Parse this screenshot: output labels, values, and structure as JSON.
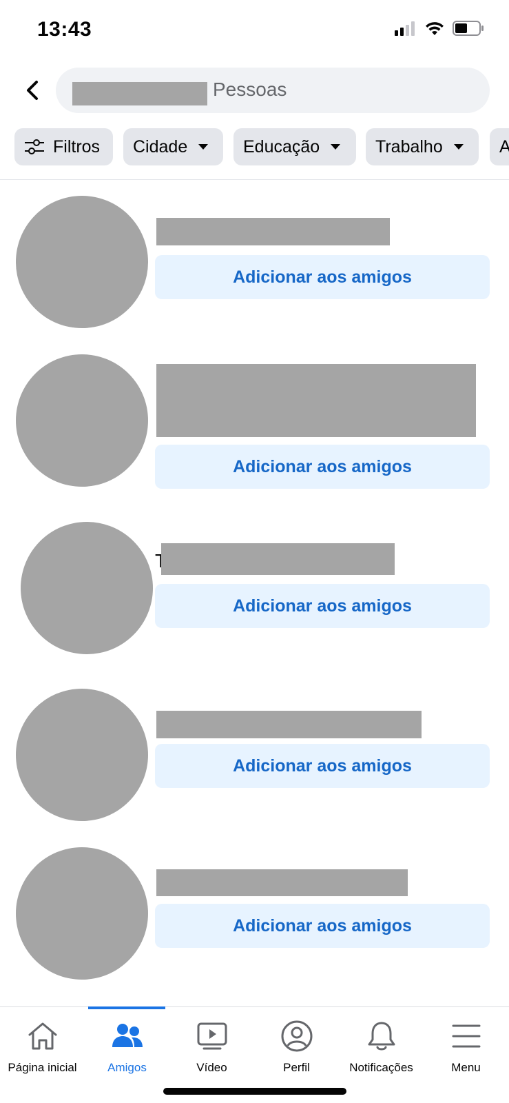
{
  "status_bar": {
    "time": "13:43",
    "battery_level": 0.5
  },
  "search": {
    "scope_label": "Pessoas"
  },
  "filters": [
    {
      "label": "Filtros"
    },
    {
      "label": "Cidade"
    },
    {
      "label": "Educação"
    },
    {
      "label": "Trabalho"
    },
    {
      "label": "A"
    }
  ],
  "results": [
    {
      "add_label": "Adicionar aos amigos"
    },
    {
      "add_label": "Adicionar aos amigos"
    },
    {
      "add_label": "Adicionar aos amigos",
      "name_visible_prefix": "T"
    },
    {
      "add_label": "Adicionar aos amigos"
    },
    {
      "add_label": "Adicionar aos amigos"
    }
  ],
  "tabbar": {
    "active_tab": "Amigos",
    "accent_color": "#1b74e4",
    "tabs": [
      {
        "label": "Página inicial",
        "icon": "home-icon"
      },
      {
        "label": "Amigos",
        "icon": "friends-icon"
      },
      {
        "label": "Vídeo",
        "icon": "video-icon"
      },
      {
        "label": "Perfil",
        "icon": "profile-icon"
      },
      {
        "label": "Notificações",
        "icon": "bell-icon"
      },
      {
        "label": "Menu",
        "icon": "menu-icon"
      }
    ]
  }
}
